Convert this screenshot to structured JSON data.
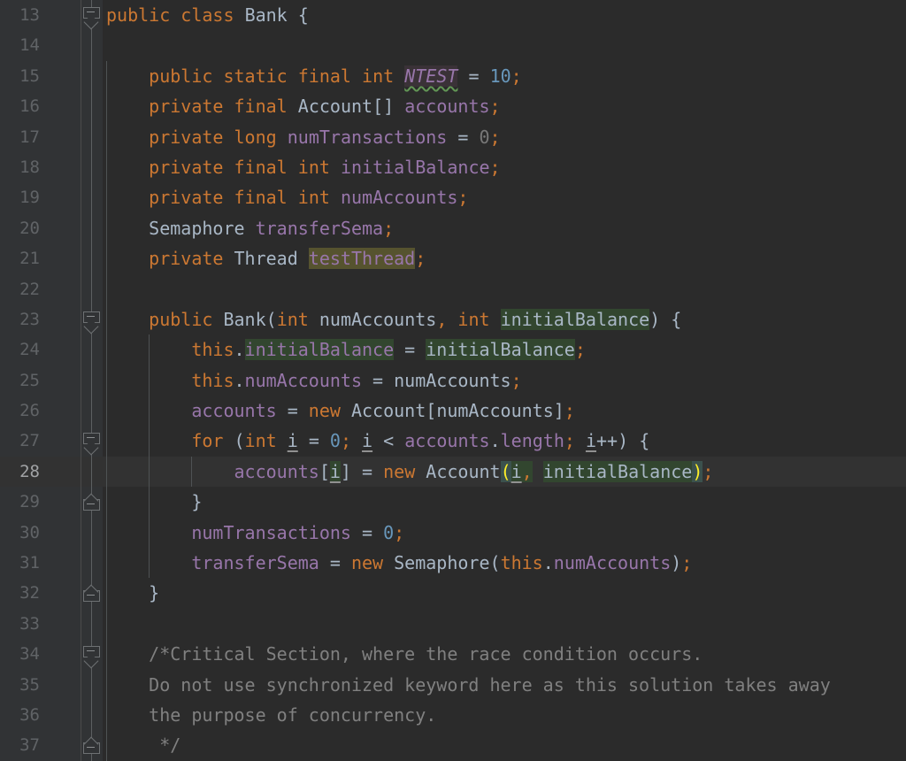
{
  "editor": {
    "language": "java",
    "theme": "darcula",
    "background": "#2b2b2b",
    "gutter_background": "#313335",
    "current_line_background": "#323232",
    "current_line_number": 28,
    "first_line_number": 13,
    "colors": {
      "keyword": "#cc7832",
      "type": "#a9b7c6",
      "field": "#9876aa",
      "local": "#a9b7c6",
      "number": "#6897bb",
      "number_dim": "#787878",
      "method": "#ffc66d",
      "comment": "#808080",
      "line_number": "#606366",
      "line_number_current": "#a1a3a5",
      "highlight_write": "#56532f",
      "highlight_read": "#32462f",
      "matched_brace_bg": "#3b514d",
      "matched_brace_fg": "#ffef28",
      "warning_squiggle": "#629755",
      "indent_guide": "#4e5254"
    }
  },
  "lines": [
    {
      "n": 13,
      "indent": 0,
      "fold": "down",
      "text": "public class Bank {"
    },
    {
      "n": 14,
      "indent": 0,
      "fold": "none",
      "text": ""
    },
    {
      "n": 15,
      "indent": 1,
      "fold": "none",
      "text": "    public static final int NTEST = 10;"
    },
    {
      "n": 16,
      "indent": 1,
      "fold": "none",
      "text": "    private final Account[] accounts;"
    },
    {
      "n": 17,
      "indent": 1,
      "fold": "none",
      "text": "    private long numTransactions = 0;"
    },
    {
      "n": 18,
      "indent": 1,
      "fold": "none",
      "text": "    private final int initialBalance;"
    },
    {
      "n": 19,
      "indent": 1,
      "fold": "none",
      "text": "    private final int numAccounts;"
    },
    {
      "n": 20,
      "indent": 1,
      "fold": "none",
      "text": "    Semaphore transferSema;"
    },
    {
      "n": 21,
      "indent": 1,
      "fold": "none",
      "text": "    private Thread testThread;"
    },
    {
      "n": 22,
      "indent": 1,
      "fold": "none",
      "text": ""
    },
    {
      "n": 23,
      "indent": 1,
      "fold": "down",
      "text": "    public Bank(int numAccounts, int initialBalance) {"
    },
    {
      "n": 24,
      "indent": 2,
      "fold": "none",
      "text": "        this.initialBalance = initialBalance;"
    },
    {
      "n": 25,
      "indent": 2,
      "fold": "none",
      "text": "        this.numAccounts = numAccounts;"
    },
    {
      "n": 26,
      "indent": 2,
      "fold": "none",
      "text": "        accounts = new Account[numAccounts];"
    },
    {
      "n": 27,
      "indent": 2,
      "fold": "down",
      "text": "        for (int i = 0; i < accounts.length; i++) {"
    },
    {
      "n": 28,
      "indent": 3,
      "fold": "none",
      "text": "            accounts[i] = new Account(i, initialBalance);"
    },
    {
      "n": 29,
      "indent": 2,
      "fold": "up",
      "text": "        }"
    },
    {
      "n": 30,
      "indent": 2,
      "fold": "none",
      "text": "        numTransactions = 0;"
    },
    {
      "n": 31,
      "indent": 2,
      "fold": "none",
      "text": "        transferSema = new Semaphore(this.numAccounts);"
    },
    {
      "n": 32,
      "indent": 1,
      "fold": "up",
      "text": "    }"
    },
    {
      "n": 33,
      "indent": 1,
      "fold": "none",
      "text": ""
    },
    {
      "n": 34,
      "indent": 1,
      "fold": "down",
      "text": "    /*Critical Section, where the race condition occurs."
    },
    {
      "n": 35,
      "indent": 1,
      "fold": "none",
      "text": "    Do not use synchronized keyword here as this solution takes away"
    },
    {
      "n": 36,
      "indent": 1,
      "fold": "none",
      "text": "    the purpose of concurrency."
    },
    {
      "n": 37,
      "indent": 1,
      "fold": "up",
      "text": "     */"
    }
  ],
  "highlights": {
    "note": "occurrences of the symbol under the caret and the matched brace pair",
    "write_usage_tokens": [
      "testThread"
    ],
    "read_usage_tokens": [
      "initialBalance"
    ],
    "matched_braces": [
      "(",
      ")"
    ],
    "caret_symbol": "i",
    "warning_symbol": "NTEST"
  },
  "gutter": {
    "fold_marker_glyph": "minus",
    "fold_expanded": true
  }
}
